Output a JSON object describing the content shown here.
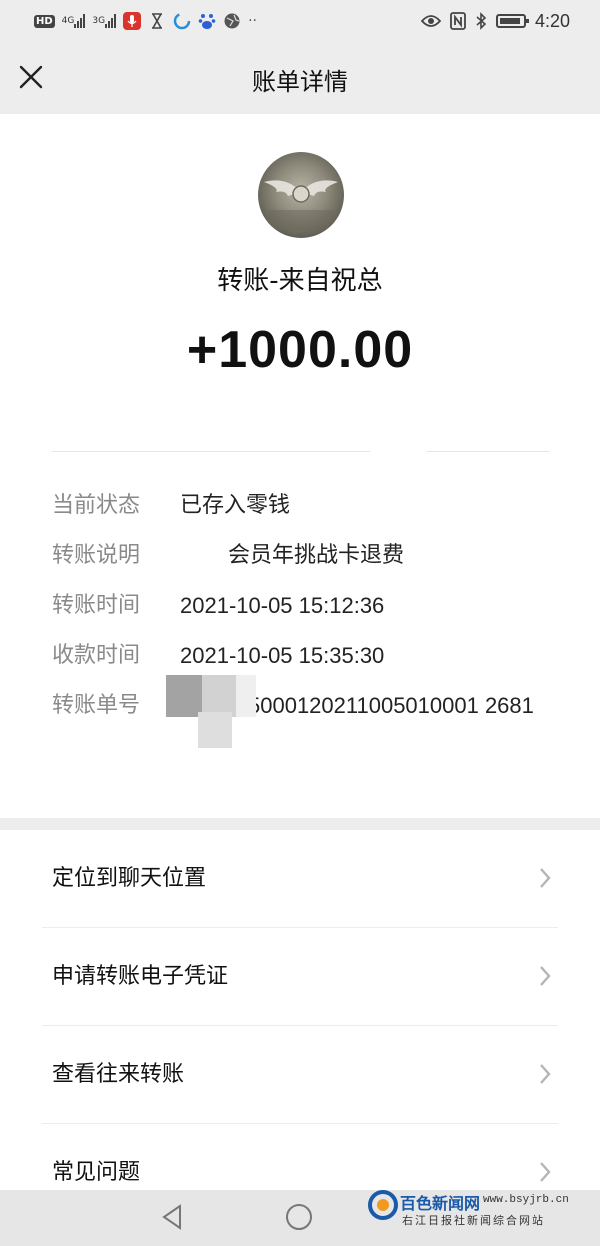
{
  "status_bar": {
    "hd_label": "HD",
    "net_4g": "4G",
    "net_3g": "3G",
    "time": "4:20",
    "left_icons": [
      "microphone-icon",
      "hourglass-icon",
      "browser-icon",
      "baidu-icon",
      "globe-icon",
      "more-dots-icon"
    ],
    "right_icons": [
      "eye-icon",
      "nfc-icon",
      "bluetooth-icon",
      "battery-icon"
    ]
  },
  "header": {
    "title": "账单详情",
    "close_icon": "close-icon"
  },
  "transfer": {
    "sender_label": "转账-来自祝总",
    "amount": "+1000.00"
  },
  "details": [
    {
      "key": "当前状态",
      "value": "已存入零钱"
    },
    {
      "key": "转账说明",
      "value": "会员年挑战卡退费"
    },
    {
      "key": "转账时间",
      "value": "2021-10-05 15:12:36"
    },
    {
      "key": "收款时间",
      "value": "2021-10-05 15:35:30"
    },
    {
      "key": "转账单号",
      "value": "5000120211005010001 2681"
    }
  ],
  "menu": [
    {
      "label": "定位到聊天位置"
    },
    {
      "label": "申请转账电子凭证"
    },
    {
      "label": "查看往来转账"
    },
    {
      "label": "常见问题"
    }
  ],
  "watermark": {
    "brand": "百色新闻网",
    "url": "www.bsyjrb.cn",
    "subtitle": "右江日报社新闻综合网站"
  },
  "colors": {
    "background": "#ededed",
    "card": "#ffffff",
    "label_gray": "#8a8a8a",
    "watermark_blue": "#1a5aa8"
  }
}
